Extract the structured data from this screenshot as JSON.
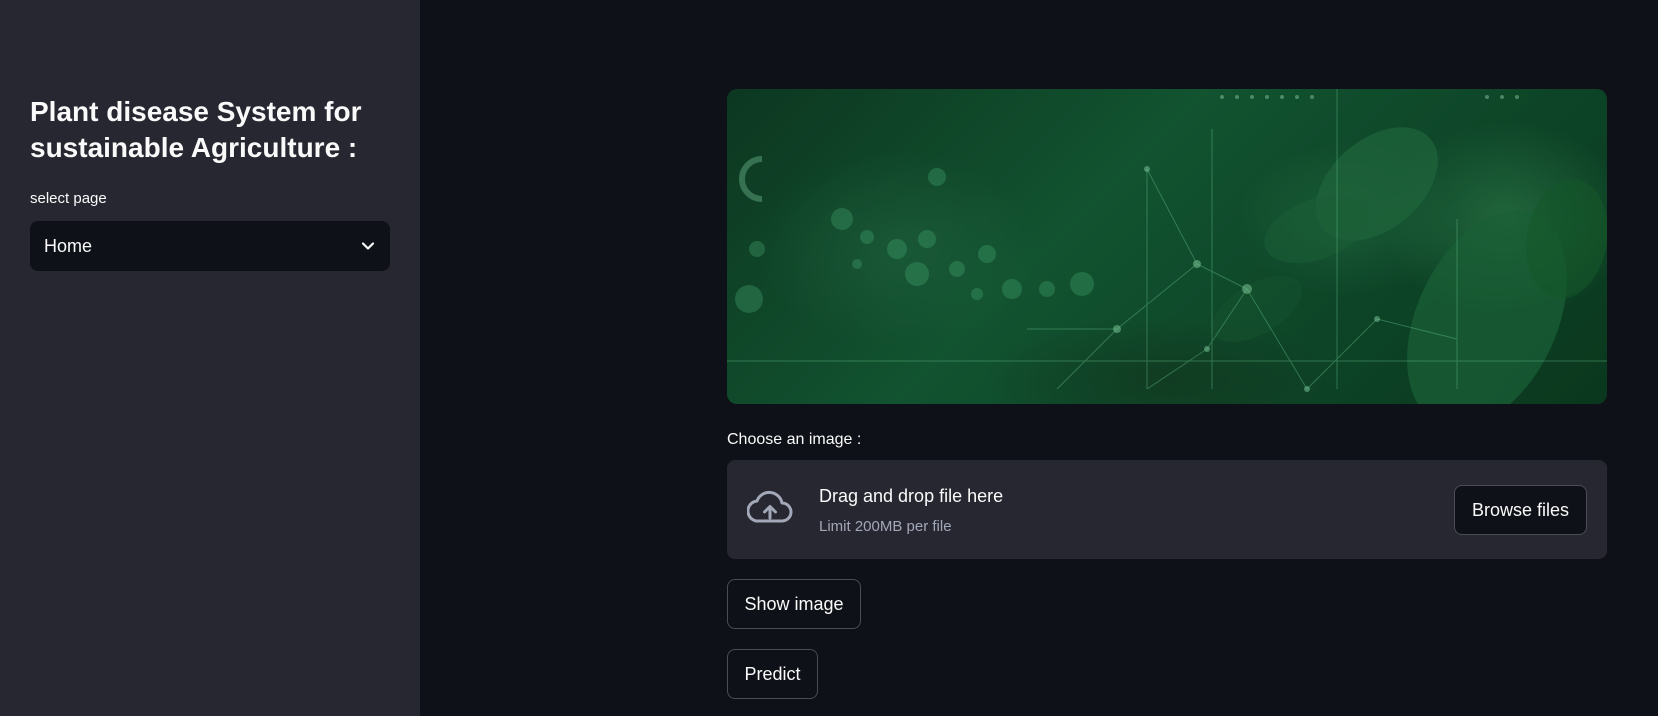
{
  "sidebar": {
    "title": "Plant disease System for sustainable Agriculture :",
    "select_label": "select page",
    "select_value": "Home",
    "select_icon": "chevron-down-icon"
  },
  "main": {
    "hero_image": "plant-leaves-network-banner",
    "uploader": {
      "label": "Choose an image :",
      "drop_title": "Drag and drop file here",
      "drop_limit": "Limit 200MB per file",
      "browse_label": "Browse files",
      "icon": "cloud-upload-icon"
    },
    "show_image_label": "Show image",
    "predict_label": "Predict"
  },
  "colors": {
    "background": "#0e1117",
    "sidebar": "#262730",
    "text": "#fafafa",
    "muted_text": "#a3a8b8",
    "hero_green": "#145c36"
  }
}
